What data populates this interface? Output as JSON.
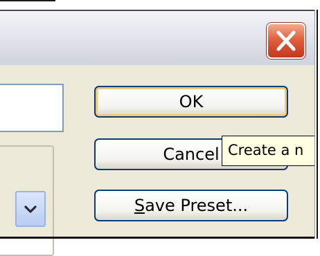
{
  "dialog": {
    "close_icon": "close-x-icon",
    "close_color": "#d6532f"
  },
  "buttons": {
    "ok_label": "OK",
    "cancel_label": "Cancel",
    "save_preset_mnemonic": "S",
    "save_preset_rest": "ave Preset..."
  },
  "tooltip": {
    "text": "Create a n"
  },
  "dropdown": {
    "icon": "chevron-down-icon"
  },
  "colors": {
    "button_border": "#0b3a7a",
    "default_focus": "#f4c775",
    "tooltip_bg": "#ffffe1",
    "dialog_bg": "#ece9d8"
  }
}
